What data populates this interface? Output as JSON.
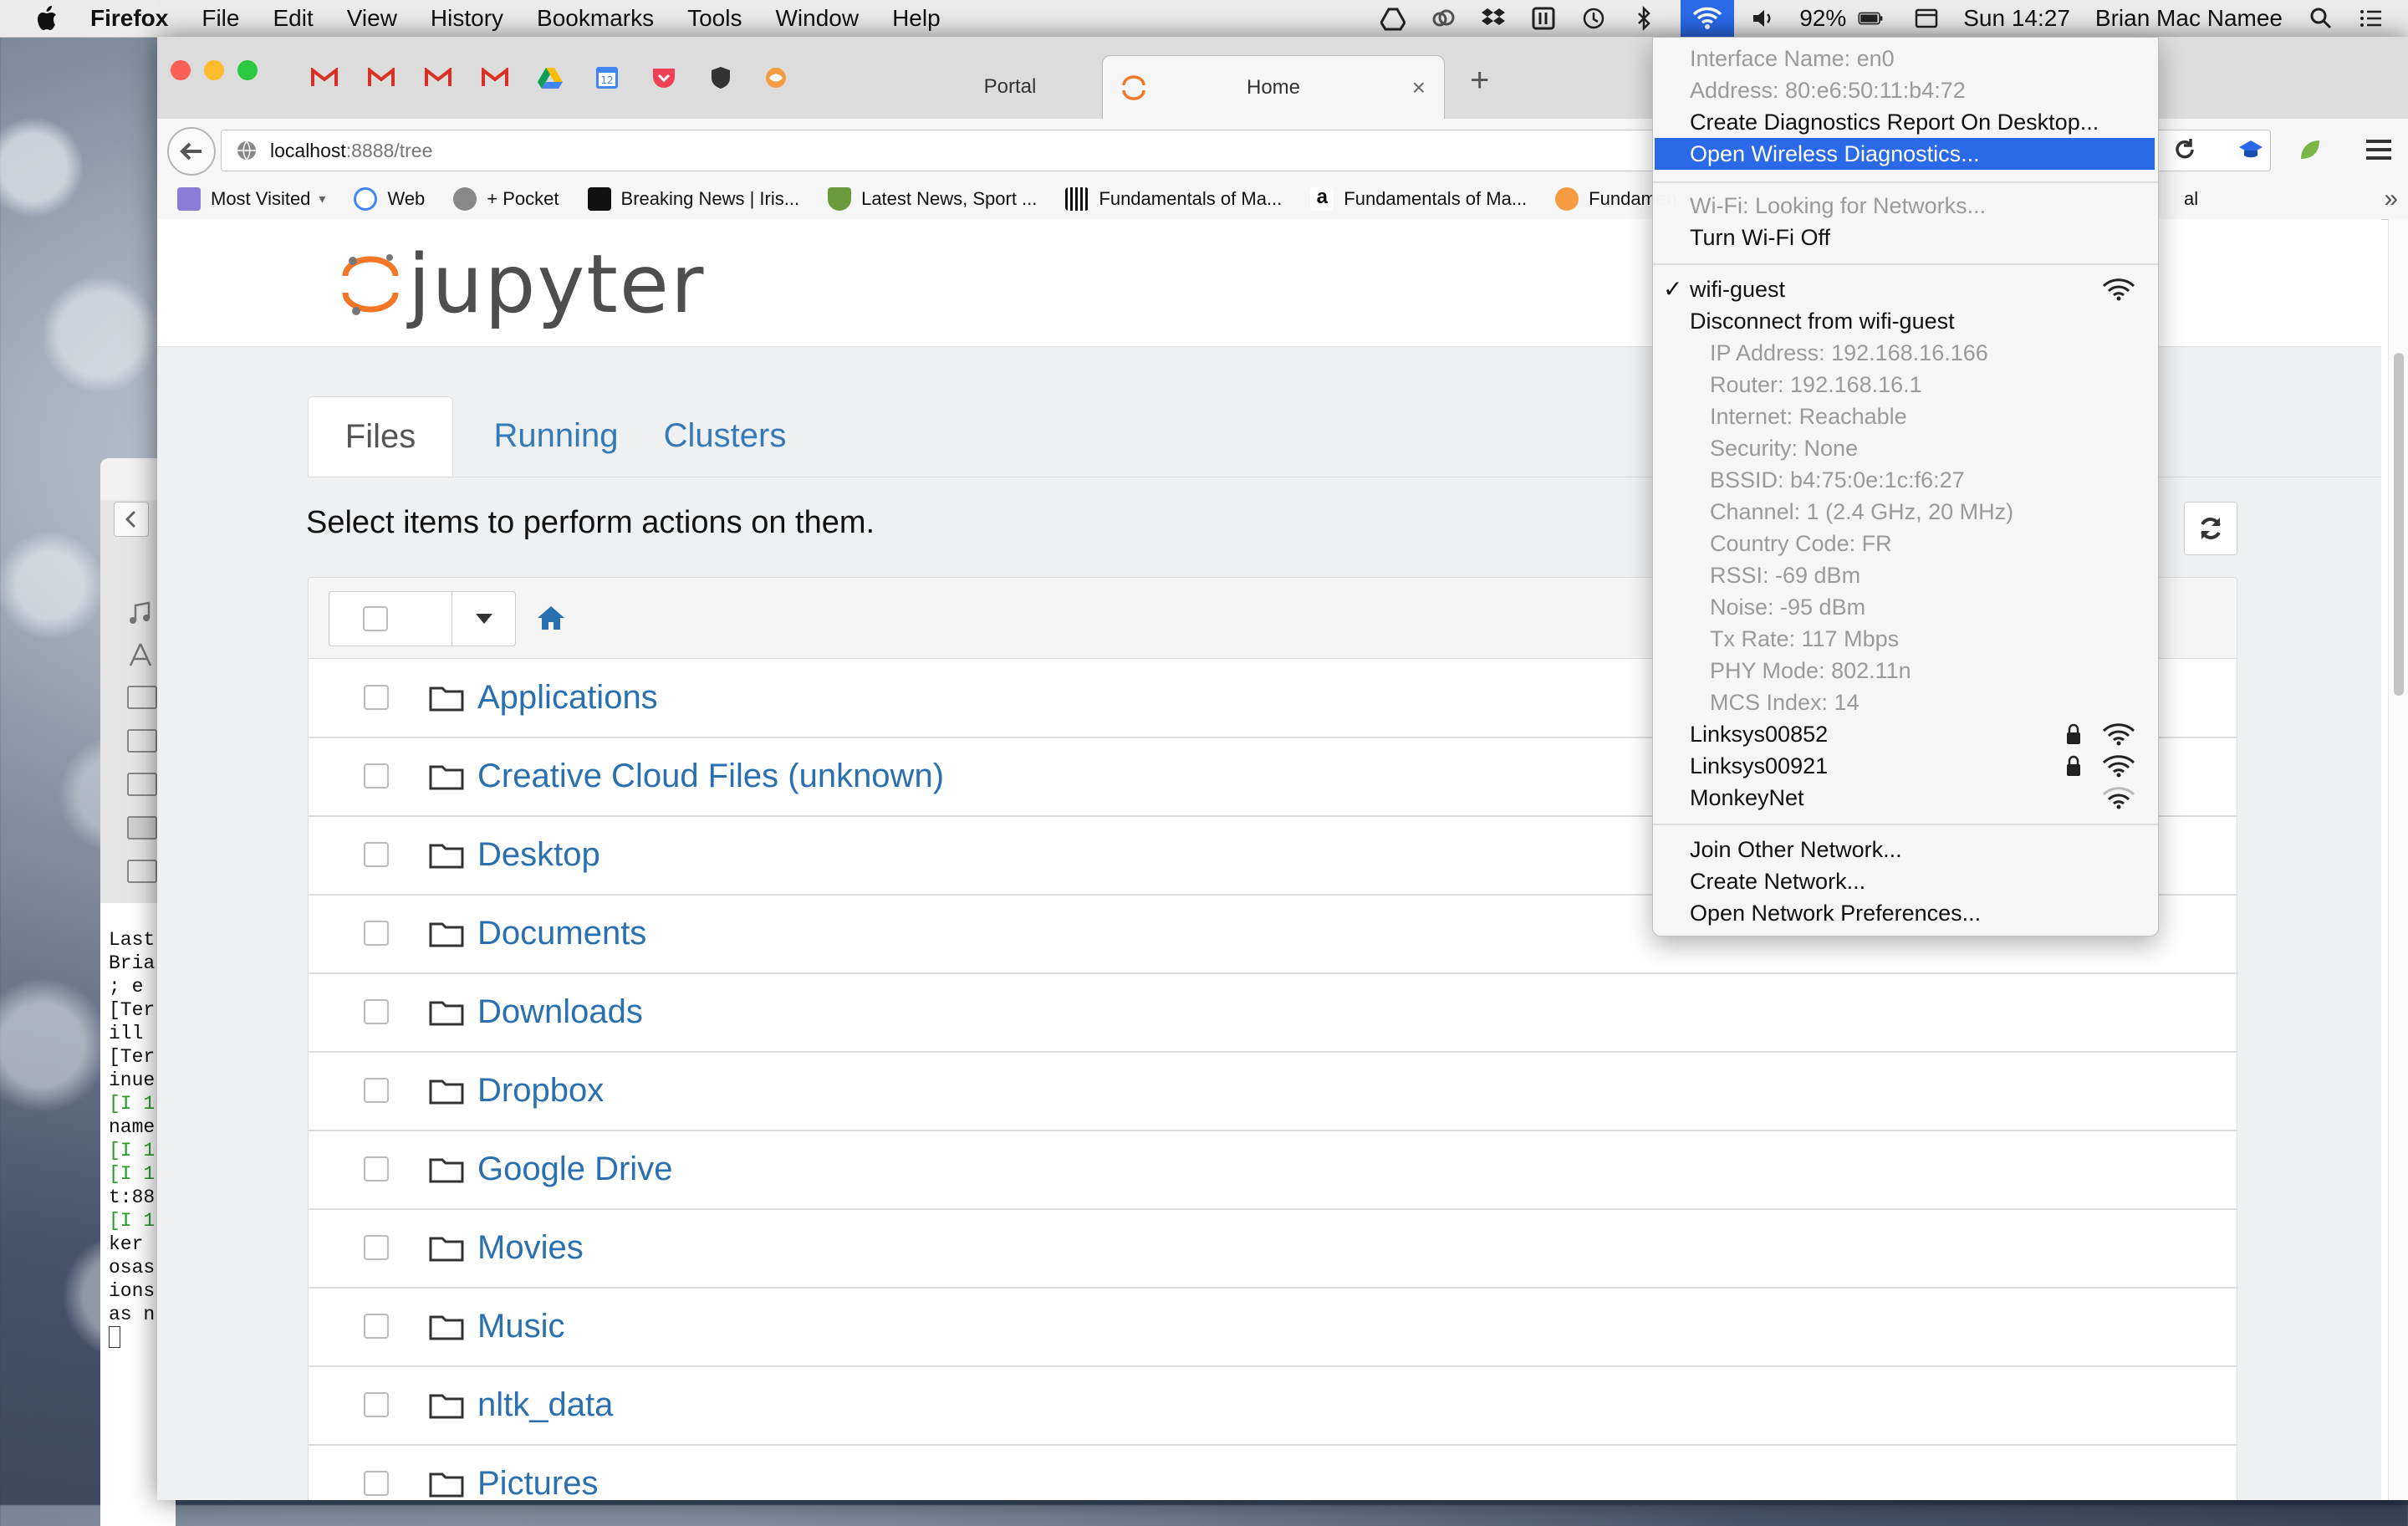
{
  "menubar": {
    "app_name": "Firefox",
    "menus": [
      "File",
      "Edit",
      "View",
      "History",
      "Bookmarks",
      "Tools",
      "Window",
      "Help"
    ],
    "battery": "92%",
    "clock": "Sun 14:27",
    "user": "Brian Mac Namee"
  },
  "browser": {
    "tabs": [
      {
        "label": "Portal"
      },
      {
        "label": "Home"
      }
    ],
    "new_tab_symbol": "+",
    "close_symbol": "×",
    "url_host": "localhost",
    "url_rest": ":8888/tree",
    "bookmarks": [
      "Most Visited",
      "Web",
      "+ Pocket",
      "Breaking News | Iris...",
      "Latest News, Sport ...",
      "Fundamentals of Ma...",
      "Fundamentals of Ma...",
      "Fundamen",
      "al"
    ],
    "bookmarks_overflow": "»"
  },
  "jupyter": {
    "logo_text": "jupyter",
    "tabs": [
      "Files",
      "Running",
      "Clusters"
    ],
    "select_message": "Select items to perform actions on them.",
    "items": [
      "Applications",
      "Creative Cloud Files (unknown)",
      "Desktop",
      "Documents",
      "Downloads",
      "Dropbox",
      "Google Drive",
      "Movies",
      "Music",
      "nltk_data",
      "Pictures"
    ]
  },
  "terminal": {
    "lines": [
      "Last",
      "Bria",
      " ; e",
      "[Ter",
      "ill",
      "[Ter",
      "inue",
      "[I 1",
      "name",
      "[I 1",
      "[I 1",
      "t:88",
      "[I 1",
      " ker",
      "osas",
      "ions",
      "as n"
    ]
  },
  "wifi_menu": {
    "interface_name": "Interface Name: en0",
    "address": "Address: 80:e6:50:11:b4:72",
    "create_report": "Create Diagnostics Report On Desktop...",
    "open_diagnostics": "Open Wireless Diagnostics...",
    "looking": "Wi-Fi: Looking for Networks...",
    "turn_off": "Turn Wi-Fi Off",
    "current_network": "wifi-guest",
    "check_mark": "✓",
    "disconnect": "Disconnect from wifi-guest",
    "details": [
      "IP Address: 192.168.16.166",
      "Router: 192.168.16.1",
      "Internet: Reachable",
      "Security: None",
      "BSSID: b4:75:0e:1c:f6:27",
      "Channel: 1 (2.4 GHz, 20 MHz)",
      "Country Code: FR",
      "RSSI: -69 dBm",
      "Noise: -95 dBm",
      "Tx Rate: 117 Mbps",
      "PHY Mode: 802.11n",
      "MCS Index: 14"
    ],
    "other_networks": [
      "Linksys00852",
      "Linksys00921",
      "MonkeyNet"
    ],
    "join_other": "Join Other Network...",
    "create_network": "Create Network...",
    "open_prefs": "Open Network Preferences..."
  },
  "colors": {
    "menu_highlight": "#2a6ae9",
    "link_blue": "#2a6fb0",
    "jupyter_orange": "#f37726"
  }
}
